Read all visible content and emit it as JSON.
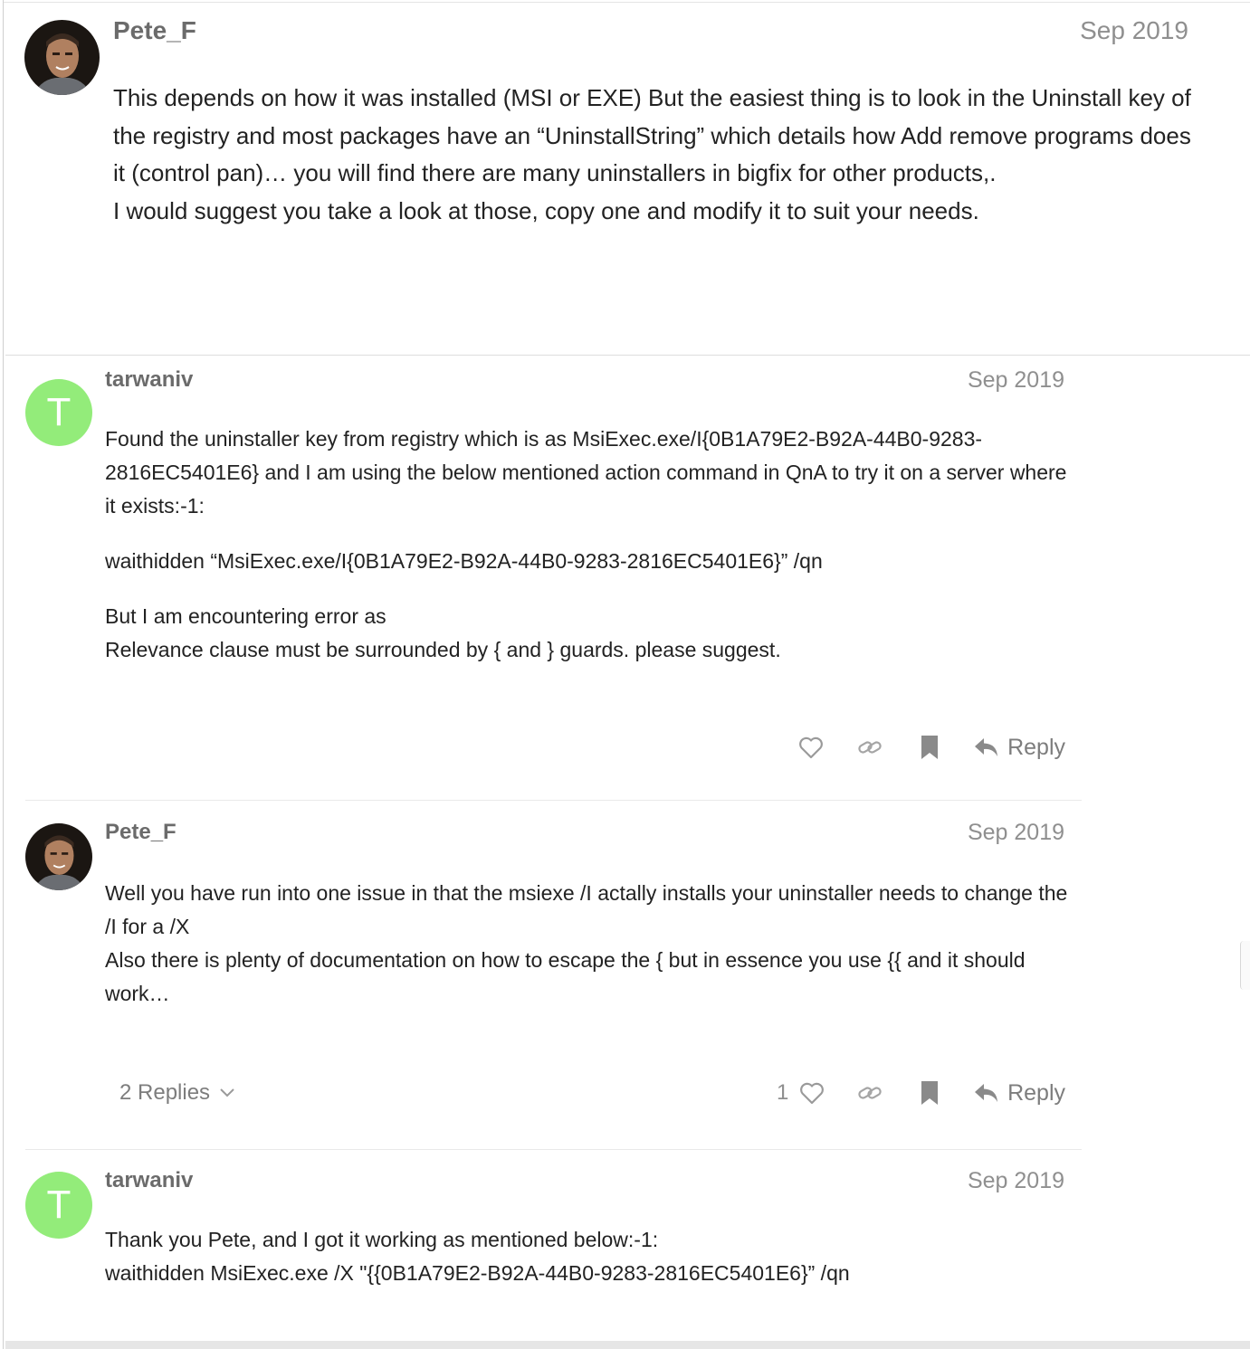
{
  "posts": [
    {
      "username": "Pete_F",
      "date": "Sep 2019",
      "avatar": "user-photo",
      "body": [
        "This depends on how it was installed (MSI or EXE) But the easiest thing is to look in the Uninstall key of the registry and most packages have an “UninstallString” which details how Add remove programs does it (control pan)… you will find there are many uninstallers in bigfix for other products,.",
        "I would suggest you take a look at those, copy one and modify it to suit your needs."
      ]
    },
    {
      "username": "tarwaniv",
      "date": "Sep 2019",
      "avatar_letter": "T",
      "avatar_color": "#93ec7a",
      "body": [
        "Found the uninstaller key from registry which is as MsiExec.exe/I{0B1A79E2-B92A-44B0-9283-2816EC5401E6} and I am using the below mentioned action command in QnA to try it on a server where it exists:-1:",
        "waithidden “MsiExec.exe/I{0B1A79E2-B92A-44B0-9283-2816EC5401E6}” /qn",
        "But I am encountering error as",
        "Relevance clause must be surrounded by { and } guards. please suggest."
      ],
      "actions": {
        "reply_label": "Reply"
      }
    },
    {
      "username": "Pete_F",
      "date": "Sep 2019",
      "avatar": "user-photo",
      "body": [
        "Well you have run into one issue in that the msiexe /I actally installs your uninstaller needs to change the /I for a /X",
        "Also there is plenty of documentation on how to escape the { but in essence you use {{ and it should work…"
      ],
      "actions": {
        "replies_label": "2 Replies",
        "like_count": "1",
        "reply_label": "Reply"
      }
    },
    {
      "username": "tarwaniv",
      "date": "Sep 2019",
      "avatar_letter": "T",
      "avatar_color": "#93ec7a",
      "body": [
        "Thank you Pete, and I got it working as mentioned below:-1:",
        "waithidden MsiExec.exe /X \"{{0B1A79E2-B92A-44B0-9283-2816EC5401E6}” /qn"
      ]
    }
  ],
  "icons": [
    "heart-icon",
    "link-icon",
    "bookmark-icon",
    "reply-arrow-icon",
    "chevron-down-icon"
  ],
  "colors": {
    "avatar_green": "#93ec7a",
    "muted_text": "#8f8f8f",
    "username": "#6b6b6b"
  }
}
